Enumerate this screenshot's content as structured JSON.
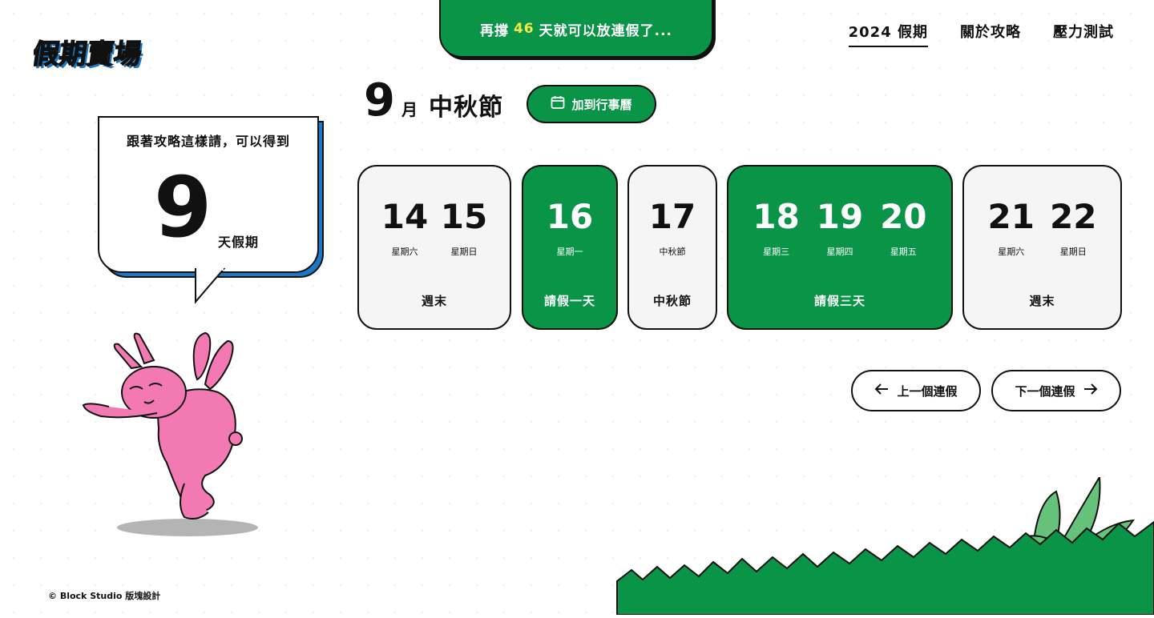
{
  "logo": {
    "text": "假期賣場"
  },
  "banner": {
    "prefix": "再撐",
    "days": "46",
    "suffix": "天就可以放連假了..."
  },
  "nav": {
    "items": [
      {
        "label": "2024 假期",
        "active": true
      },
      {
        "label": "關於攻略",
        "active": false
      },
      {
        "label": "壓力測試",
        "active": false
      }
    ]
  },
  "heading": {
    "month_num": "9",
    "month_label": "月",
    "holiday_name": "中秋節"
  },
  "calendar_button": {
    "label": "加到行事曆",
    "icon": "calendar-icon"
  },
  "bubble": {
    "text": "跟著攻略這樣請，可以得到",
    "days": "9",
    "unit": "天假期"
  },
  "cards": [
    {
      "days": [
        {
          "num": "14",
          "weekday": "星期六"
        },
        {
          "num": "15",
          "weekday": "星期日"
        }
      ],
      "label": "週末"
    },
    {
      "days": [
        {
          "num": "16",
          "weekday": "星期一"
        }
      ],
      "label": "請假一天"
    },
    {
      "days": [
        {
          "num": "17",
          "weekday": "中秋節"
        }
      ],
      "label": "中秋節"
    },
    {
      "days": [
        {
          "num": "18",
          "weekday": "星期三"
        },
        {
          "num": "19",
          "weekday": "星期四"
        },
        {
          "num": "20",
          "weekday": "星期五"
        }
      ],
      "label": "請假三天"
    },
    {
      "days": [
        {
          "num": "21",
          "weekday": "星期六"
        },
        {
          "num": "22",
          "weekday": "星期日"
        }
      ],
      "label": "週末"
    }
  ],
  "pager": {
    "prev_label": "上一個連假",
    "next_label": "下一個連假"
  },
  "footer": {
    "text": "© Block Studio 版塊設計"
  },
  "colors": {
    "green": "#0a9447",
    "blue": "#1a79c7",
    "pink": "#f279b1",
    "yellow": "#f3e84a"
  }
}
